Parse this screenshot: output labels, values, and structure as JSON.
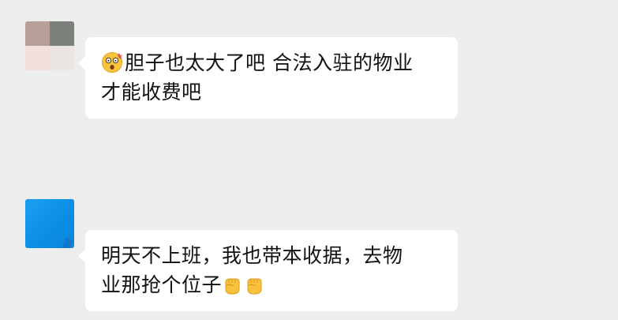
{
  "conversation": {
    "messages": [
      {
        "sender": "contact-1",
        "avatar_colors": [
          "#b79e98",
          "#7b807b",
          "#f1dfde",
          "#ebe6e4"
        ],
        "text_line1": "胆子也太大了吧  合法入驻的物业",
        "text_line2": "才能收费吧",
        "emoji_prefix": "astonished-face"
      },
      {
        "sender": "contact-2",
        "avatar_color": "#1095ec",
        "text_line1": "明天不上班，我也带本收据，去物",
        "text_line2": "业那抢个位子",
        "emoji_suffix": [
          "raised-fist",
          "raised-fist"
        ]
      }
    ]
  }
}
